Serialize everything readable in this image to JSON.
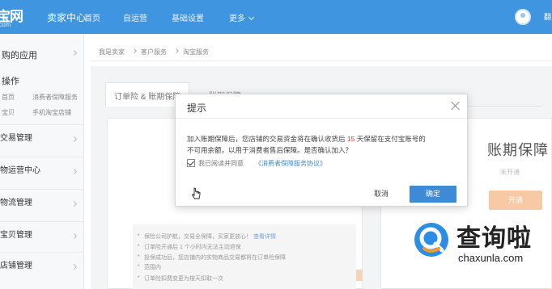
{
  "header": {
    "logo_main": "宝网",
    "logo_sub": ".com",
    "seller_center": "卖家中心",
    "nav": [
      {
        "label": "首页"
      },
      {
        "label": "自运营"
      },
      {
        "label": "基础设置"
      },
      {
        "label": "更多"
      }
    ],
    "user_name": "翻"
  },
  "sidebar": {
    "apps_heading": "购的应用",
    "quick_heading": "操作",
    "quick_links": [
      "首页",
      "消费者保障服务",
      "宝贝",
      "手机淘宝店铺"
    ],
    "menus": [
      {
        "label": "交易管理"
      },
      {
        "label": "物运营中心"
      },
      {
        "label": "物流管理"
      },
      {
        "label": "宝贝管理"
      },
      {
        "label": "店铺管理"
      }
    ]
  },
  "breadcrumb": [
    "我是卖家",
    "客户服务",
    "淘宝服务"
  ],
  "content": {
    "tabs": [
      "订单险 & 账期保障",
      "账期保障"
    ],
    "notes": [
      {
        "text": "保险公司护航，交易全保障，买家更放心！",
        "link": "查看详情"
      },
      {
        "text": "订单险开通后 1 个小时内无法主动退保",
        "link": ""
      },
      {
        "text": "投保成功后，您店铺内的实物商品交易都将在订单险保障",
        "link": ""
      },
      {
        "text": "范围内",
        "link": ""
      },
      {
        "text": "订单险扣费变更为按天扣取一次",
        "link": ""
      }
    ],
    "right_card": {
      "title": "账期保障",
      "status": "未开通",
      "open_button": "开通"
    }
  },
  "dialog": {
    "title": "提示",
    "message_part1": "加入账期保障后，您店铺的交易资金将在确认收货后",
    "days": "15",
    "message_part2": "天保留在支付宝账号的",
    "message_line2": "不可用余额，以用于消费者售后保障。是否确认加入？",
    "checkbox_label": "我已阅读并同意",
    "agreement_link": "《消费者保障服务协议》",
    "checkbox_checked": true,
    "cancel_label": "取消",
    "confirm_label": "确定"
  },
  "watermark": {
    "title": "查询啦",
    "sub": "chaxunla.com"
  },
  "colors": {
    "topbar": "#3f95e0",
    "primary_button": "#3f8ad6",
    "highlight_number": "#e4393c",
    "open_button": "#f7c9a5",
    "watermark_blue": "#2b8de3"
  }
}
